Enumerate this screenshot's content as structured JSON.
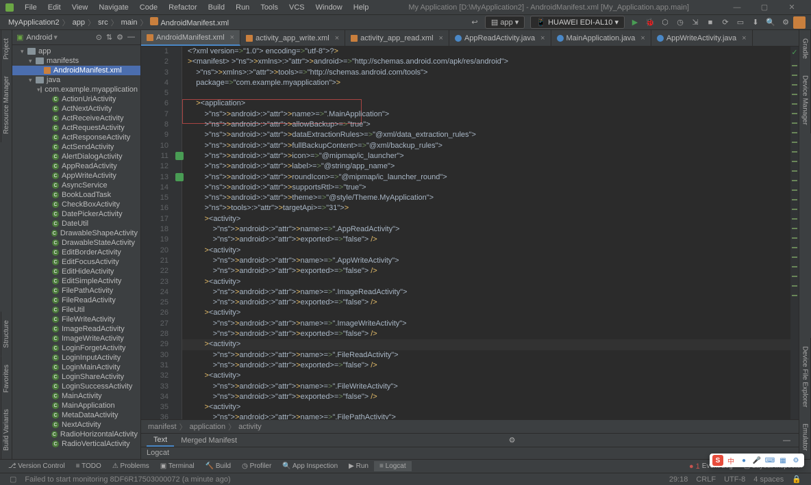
{
  "window_title": "My Application [D:\\MyApplication2] - AndroidManifest.xml [My_Application.app.main]",
  "menu": [
    "File",
    "Edit",
    "View",
    "Navigate",
    "Code",
    "Refactor",
    "Build",
    "Run",
    "Tools",
    "VCS",
    "Window",
    "Help"
  ],
  "breadcrumbs": [
    "MyApplication2",
    "app",
    "src",
    "main",
    "AndroidManifest.xml"
  ],
  "run_config": {
    "app": "app",
    "device": "HUAWEI EDI-AL10 ▾"
  },
  "project": {
    "label": "Android",
    "tree": [
      {
        "l": "app",
        "t": "folder",
        "i": 1,
        "open": true
      },
      {
        "l": "manifests",
        "t": "folder",
        "i": 2,
        "open": true
      },
      {
        "l": "AndroidManifest.xml",
        "t": "xml",
        "i": 3,
        "sel": true
      },
      {
        "l": "java",
        "t": "folder",
        "i": 2,
        "open": true
      },
      {
        "l": "com.example.myapplication",
        "t": "pkg",
        "i": 3,
        "open": true
      },
      {
        "l": "ActionUriActivity",
        "t": "cls",
        "i": 4
      },
      {
        "l": "ActNextActivity",
        "t": "cls",
        "i": 4
      },
      {
        "l": "ActReceiveActivity",
        "t": "cls",
        "i": 4
      },
      {
        "l": "ActRequestActivity",
        "t": "cls",
        "i": 4
      },
      {
        "l": "ActResponseActivity",
        "t": "cls",
        "i": 4
      },
      {
        "l": "ActSendActivity",
        "t": "cls",
        "i": 4
      },
      {
        "l": "AlertDialogActivity",
        "t": "cls",
        "i": 4
      },
      {
        "l": "AppReadActivity",
        "t": "cls",
        "i": 4
      },
      {
        "l": "AppWriteActivity",
        "t": "cls",
        "i": 4
      },
      {
        "l": "AsyncService",
        "t": "cls",
        "i": 4
      },
      {
        "l": "BookLoadTask",
        "t": "cls",
        "i": 4
      },
      {
        "l": "CheckBoxActivity",
        "t": "cls",
        "i": 4
      },
      {
        "l": "DatePickerActivity",
        "t": "cls",
        "i": 4
      },
      {
        "l": "DateUtil",
        "t": "cls",
        "i": 4
      },
      {
        "l": "DrawableShapeActivity",
        "t": "cls",
        "i": 4
      },
      {
        "l": "DrawableStateActivity",
        "t": "cls",
        "i": 4
      },
      {
        "l": "EditBorderActivity",
        "t": "cls",
        "i": 4
      },
      {
        "l": "EditFocusActivity",
        "t": "cls",
        "i": 4
      },
      {
        "l": "EditHideActivity",
        "t": "cls",
        "i": 4
      },
      {
        "l": "EditSimpleActivity",
        "t": "cls",
        "i": 4
      },
      {
        "l": "FilePathActivity",
        "t": "cls",
        "i": 4
      },
      {
        "l": "FileReadActivity",
        "t": "cls",
        "i": 4
      },
      {
        "l": "FileUtil",
        "t": "cls",
        "i": 4
      },
      {
        "l": "FileWriteActivity",
        "t": "cls",
        "i": 4
      },
      {
        "l": "ImageReadActivity",
        "t": "cls",
        "i": 4
      },
      {
        "l": "ImageWriteActivity",
        "t": "cls",
        "i": 4
      },
      {
        "l": "LoginForgetActivity",
        "t": "cls",
        "i": 4
      },
      {
        "l": "LoginInputActivity",
        "t": "cls",
        "i": 4
      },
      {
        "l": "LoginMainActivity",
        "t": "cls",
        "i": 4
      },
      {
        "l": "LoginShareActivity",
        "t": "cls",
        "i": 4
      },
      {
        "l": "LoginSuccessActivity",
        "t": "cls",
        "i": 4
      },
      {
        "l": "MainActivity",
        "t": "cls",
        "i": 4
      },
      {
        "l": "MainApplication",
        "t": "cls",
        "i": 4
      },
      {
        "l": "MetaDataActivity",
        "t": "cls",
        "i": 4
      },
      {
        "l": "NextActivity",
        "t": "cls",
        "i": 4
      },
      {
        "l": "RadioHorizontalActivity",
        "t": "cls",
        "i": 4
      },
      {
        "l": "RadioVerticalActivity",
        "t": "cls",
        "i": 4
      }
    ]
  },
  "editor_tabs": [
    {
      "l": "AndroidManifest.xml",
      "icon": "xml",
      "active": true
    },
    {
      "l": "activity_app_write.xml",
      "icon": "xml"
    },
    {
      "l": "activity_app_read.xml",
      "icon": "xml"
    },
    {
      "l": "AppReadActivity.java",
      "icon": "java"
    },
    {
      "l": "MainApplication.java",
      "icon": "java"
    },
    {
      "l": "AppWriteActivity.java",
      "icon": "java"
    }
  ],
  "code_lines": [
    "<?xml version=\"1.0\" encoding=\"utf-8\"?>",
    "<manifest xmlns:android=\"http://schemas.android.com/apk/res/android\"",
    "    xmlns:tools=\"http://schemas.android.com/tools\"",
    "    package=\"com.example.myapplication\">",
    "",
    "    <application",
    "        android:name=\".MainApplication\"",
    "        android:allowBackup=\"true\"",
    "        android:dataExtractionRules=\"@xml/data_extraction_rules\"",
    "        android:fullBackupContent=\"@xml/backup_rules\"",
    "        android:icon=\"@mipmap/ic_launcher\"",
    "        android:label=\"@string/app_name\"",
    "        android:roundIcon=\"@mipmap/ic_launcher_round\"",
    "        android:supportsRtl=\"true\"",
    "        android:theme=\"@style/Theme.MyApplication\"",
    "        tools:targetApi=\"31\">",
    "        <activity",
    "            android:name=\".AppReadActivity\"",
    "            android:exported=\"false\" />",
    "        <activity",
    "            android:name=\".AppWriteActivity\"",
    "            android:exported=\"false\" />",
    "        <activity",
    "            android:name=\".ImageReadActivity\"",
    "            android:exported=\"false\" />",
    "        <activity",
    "            android:name=\".ImageWriteActivity\"",
    "            android:exported=\"false\" />",
    "        <activity",
    "            android:name=\".FileReadActivity\"",
    "            android:exported=\"false\" />",
    "        <activity",
    "            android:name=\".FileWriteActivity\"",
    "            android:exported=\"false\" />",
    "        <activity",
    "            android:name=\".FilePathActivity\""
  ],
  "code_breadcrumb": [
    "manifest",
    "application",
    "activity"
  ],
  "bottom_tabs": {
    "text": "Text",
    "merged": "Merged Manifest"
  },
  "logcat_label": "Logcat",
  "tool_windows": [
    "Version Control",
    "TODO",
    "Problems",
    "Terminal",
    "Build",
    "Profiler",
    "App Inspection",
    "Run",
    "Logcat"
  ],
  "event_log": "Event Log",
  "layout_inspector": "Layout Inspector",
  "error_count": "1",
  "status": {
    "msg": "Failed to start monitoring 8DF6R17503000072 (a minute ago)",
    "pos": "29:18",
    "crlf": "CRLF",
    "enc": "UTF-8",
    "indent": "4 spaces"
  },
  "left_tabs": [
    "Project",
    "Resource Manager"
  ],
  "left_tabs2": [
    "Structure",
    "Favorites",
    "Build Variants"
  ],
  "right_tabs": [
    "Gradle",
    "Device Manager"
  ],
  "right_tabs2": [
    "Device File Explorer",
    "Emulator"
  ]
}
